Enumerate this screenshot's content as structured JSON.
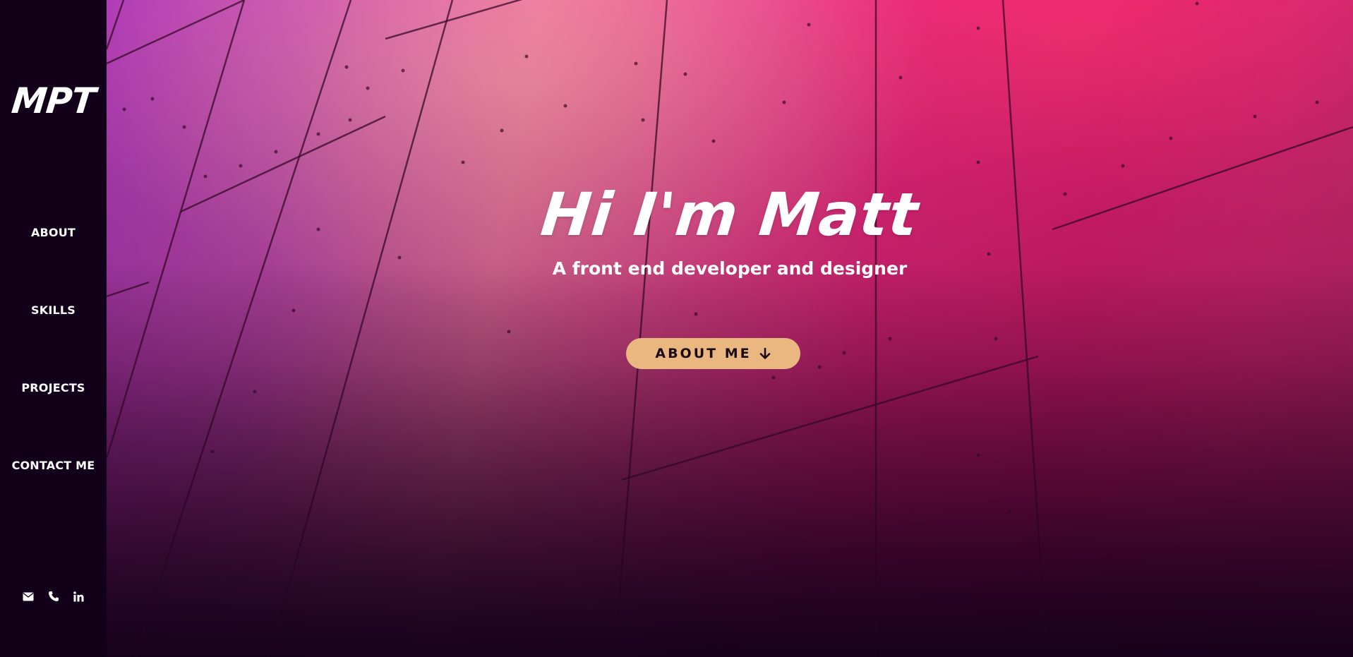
{
  "sidebar": {
    "logo": "MPT",
    "nav": [
      {
        "label": "ABOUT"
      },
      {
        "label": "SKILLS"
      },
      {
        "label": "PROJECTS"
      },
      {
        "label": "CONTACT ME"
      }
    ],
    "social": [
      {
        "icon": "envelope-icon"
      },
      {
        "icon": "phone-icon"
      },
      {
        "icon": "linkedin-icon"
      }
    ]
  },
  "hero": {
    "title": "Hi I'm Matt",
    "subtitle": "A front end developer and designer",
    "button_label": "ABOUT ME",
    "button_icon": "arrow-down-icon"
  },
  "colors": {
    "sidebar_bg": "#12001a",
    "button_bg": "#e9b77f",
    "text": "#ffffff",
    "accent_pink": "#e62679",
    "accent_purple": "#b03ab8"
  }
}
